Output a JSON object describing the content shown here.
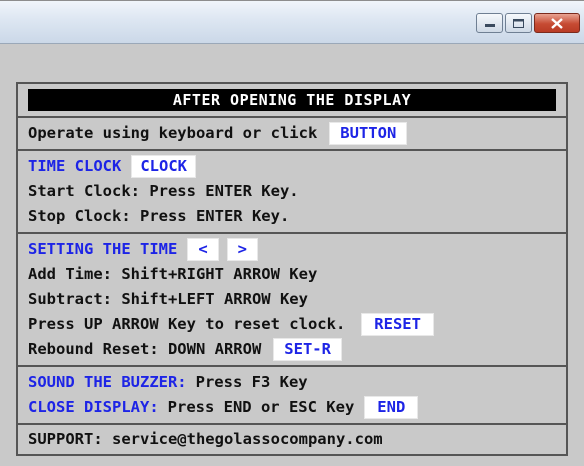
{
  "window": {
    "controls": [
      "minimize-icon",
      "maximize-icon",
      "close-icon"
    ]
  },
  "panel": {
    "header": "AFTER OPENING THE DISPLAY",
    "operate": {
      "text": "Operate using keyboard or click",
      "button": "BUTTON"
    },
    "time_clock": {
      "title": "TIME CLOCK",
      "button": "CLOCK",
      "start": "Start Clock: Press ENTER Key.",
      "stop": "Stop Clock: Press ENTER Key."
    },
    "setting_time": {
      "title": "SETTING THE TIME",
      "left_button": "<",
      "right_button": ">",
      "add": "Add Time: Shift+RIGHT ARROW Key",
      "subtract": "Subtract: Shift+LEFT ARROW Key",
      "reset_text": "Press UP ARROW Key to reset clock.",
      "reset_button": "RESET",
      "rebound_text": "Rebound Reset: DOWN ARROW",
      "rebound_button": "SET-R"
    },
    "buzzer": {
      "label": "SOUND THE BUZZER:",
      "text": "Press F3 Key"
    },
    "close_display": {
      "label": "CLOSE DISPLAY:",
      "text": "Press END or ESC Key",
      "button": "END"
    },
    "support": "SUPPORT: service@thegolassocompany.com"
  },
  "colors": {
    "background": "#c9c9c9",
    "accent_blue": "#1d24e6",
    "header_bg": "#000000",
    "button_bg": "#ffffff"
  }
}
